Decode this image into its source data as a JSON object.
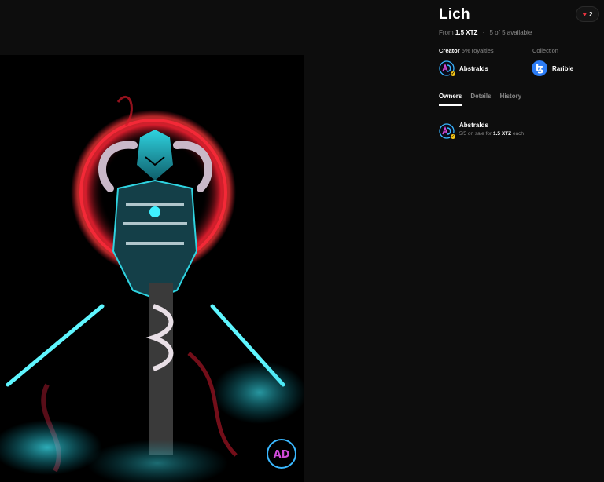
{
  "item": {
    "title": "Lich",
    "likes": "2",
    "price_prefix": "From",
    "price": "1.5 XTZ",
    "availability": "5 of 5 available"
  },
  "creator": {
    "label": "Creator",
    "royalties": "5% royalties",
    "name": "Abstralds"
  },
  "collection": {
    "label": "Collection",
    "name": "Rarible",
    "icon": "tezos-icon"
  },
  "tabs": [
    {
      "label": "Owners",
      "active": true
    },
    {
      "label": "Details",
      "active": false
    },
    {
      "label": "History",
      "active": false
    }
  ],
  "owners": [
    {
      "name": "Abstralds",
      "sale_prefix": "5/5 on sale for",
      "sale_price": "1.5 XTZ",
      "sale_suffix": "each"
    }
  ],
  "colors": {
    "background": "#0d0d0d",
    "heart": "#e8333f",
    "verified": "#f5c518",
    "tezos": "#2c7df7",
    "art_red": "#e01e2e",
    "art_cyan": "#2fd3e0"
  },
  "artwork": {
    "icon": "lich-artwork",
    "signature": "AD"
  }
}
